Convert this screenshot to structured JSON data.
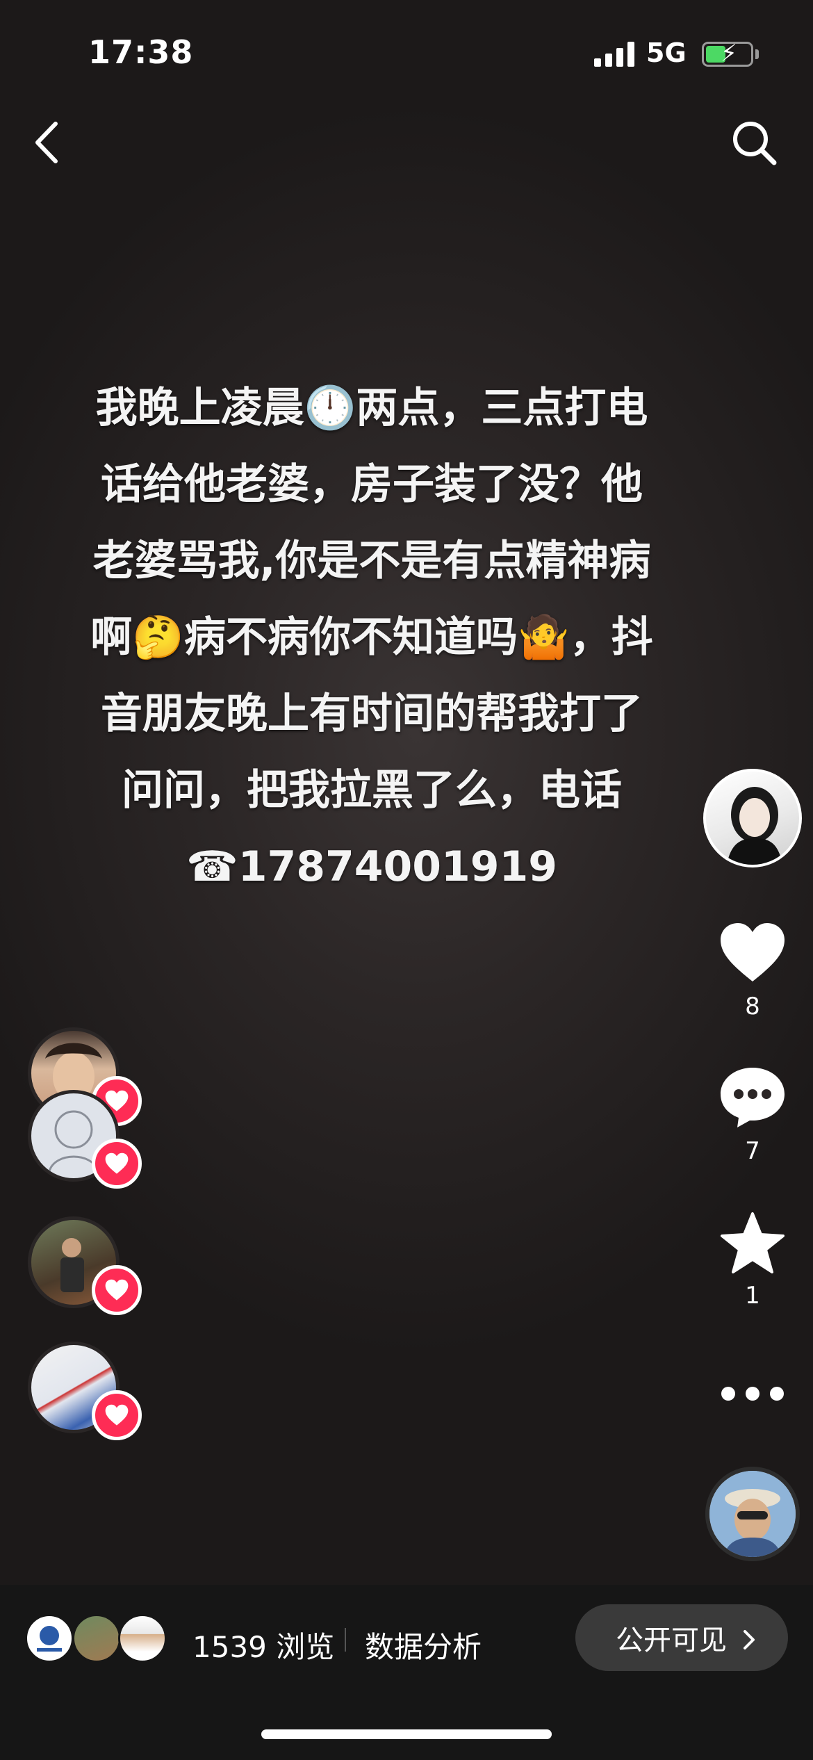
{
  "status_bar": {
    "time": "17:38",
    "network": "5G"
  },
  "caption": {
    "lines": [
      "我晚上凌晨🕛两点，三点打电",
      "话给他老婆，房子装了没？他",
      "老婆骂我,你是不是有点精神病",
      "啊🤔病不病你不知道吗🤷，抖",
      "音朋友晚上有时间的帮我打了",
      "问问，把我拉黑了么，电话",
      "☎17874001919"
    ]
  },
  "actions": {
    "like_count": "8",
    "comment_count": "7",
    "favorite_count": "1"
  },
  "bottom_bar": {
    "views": "1539 浏览",
    "analysis": "数据分析",
    "visibility": "公开可见"
  },
  "colors": {
    "like_badge": "#fe2c55",
    "battery": "#4cd964"
  }
}
